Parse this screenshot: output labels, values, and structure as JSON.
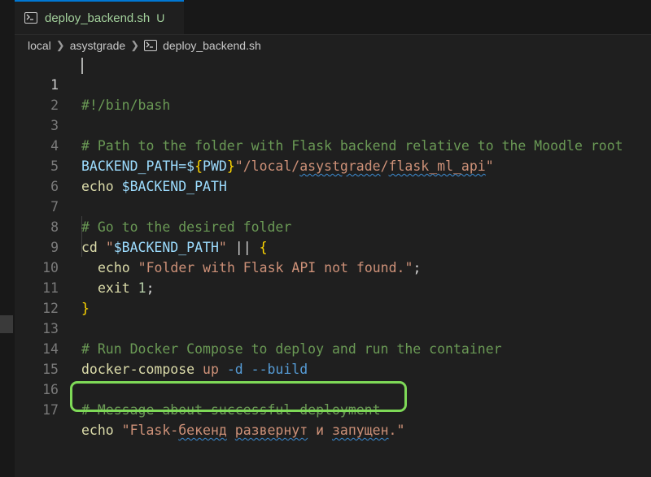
{
  "tab": {
    "label": "deploy_backend.sh",
    "status": "U"
  },
  "breadcrumb": {
    "items": [
      "local",
      "asystgrade",
      "deploy_backend.sh"
    ]
  },
  "lines": [
    {
      "n": "1",
      "t": "#!/bin/bash"
    },
    {
      "n": "2",
      "t": ""
    },
    {
      "n": "3",
      "t": "# Path to the folder with Flask backend relative to the Moodle root"
    },
    {
      "n": "4",
      "a": "BACKEND_PATH=$",
      "b": "{",
      "c": "PWD",
      "d": "}",
      "e": "\"/local/",
      "f": "asystgrade",
      "g": "/",
      "h": "flask_ml_api",
      "i": "\""
    },
    {
      "n": "5",
      "a": "echo ",
      "b": "$BACKEND_PATH"
    },
    {
      "n": "6",
      "t": ""
    },
    {
      "n": "7",
      "t": "# Go to the desired folder"
    },
    {
      "n": "8",
      "a": "cd ",
      "b": "\"",
      "c": "$BACKEND_PATH",
      "d": "\"",
      "e": " || ",
      "f": "{"
    },
    {
      "n": "9",
      "a": "echo ",
      "b": "\"Folder with Flask API not found.\"",
      "c": ";"
    },
    {
      "n": "10",
      "a": "exit ",
      "b": "1",
      "c": ";"
    },
    {
      "n": "11",
      "t": "}"
    },
    {
      "n": "12",
      "t": ""
    },
    {
      "n": "13",
      "t": "# Run Docker Compose to deploy and run the container"
    },
    {
      "n": "14",
      "a": "docker-compose ",
      "b": "up ",
      "c": "-d --build"
    },
    {
      "n": "15",
      "t": ""
    },
    {
      "n": "16",
      "t": "# Message about successful deployment"
    },
    {
      "n": "17",
      "a": "echo ",
      "b": "\"Flask-",
      "c": "бекенд",
      "d": " ",
      "e": "развернут",
      "f": " и ",
      "g": "запущен",
      "h": ".\""
    }
  ],
  "colors": {
    "accent": "#0078d4",
    "untracked": "#a3d19c",
    "highlight": "#7ed957",
    "comment": "#6a9955",
    "string": "#ce9178"
  }
}
